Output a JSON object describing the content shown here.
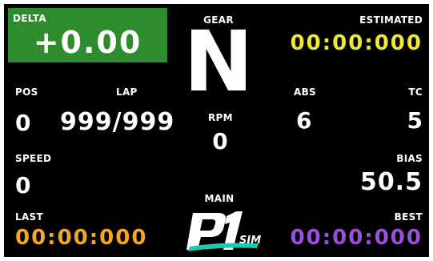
{
  "delta": {
    "label": "DELTA",
    "value": "+0.00",
    "bg_color": "#2e8b2e"
  },
  "gear": {
    "label": "GEAR",
    "value": "N"
  },
  "estimated": {
    "label": "ESTIMATED",
    "value": "00:00:000",
    "color": "#f0e92e"
  },
  "pos": {
    "label": "POS",
    "value": "0"
  },
  "lap": {
    "label": "LAP",
    "value": "999/999"
  },
  "rpm": {
    "label": "RPM",
    "value": "0"
  },
  "abs": {
    "label": "ABS",
    "value": "6"
  },
  "tc": {
    "label": "TC",
    "value": "5"
  },
  "speed": {
    "label": "SPEED",
    "value": "0"
  },
  "bias": {
    "label": "BIAS",
    "value": "50.5"
  },
  "main": {
    "label": "MAIN"
  },
  "last": {
    "label": "LAST",
    "value": "00:00:000",
    "color": "#f5a623"
  },
  "best": {
    "label": "BEST",
    "value": "00:00:000",
    "color": "#9b4fdb"
  },
  "logo": {
    "brand_text": "SIM",
    "icon": "p1-sim-logo",
    "accent_color": "#1fc8b0"
  }
}
